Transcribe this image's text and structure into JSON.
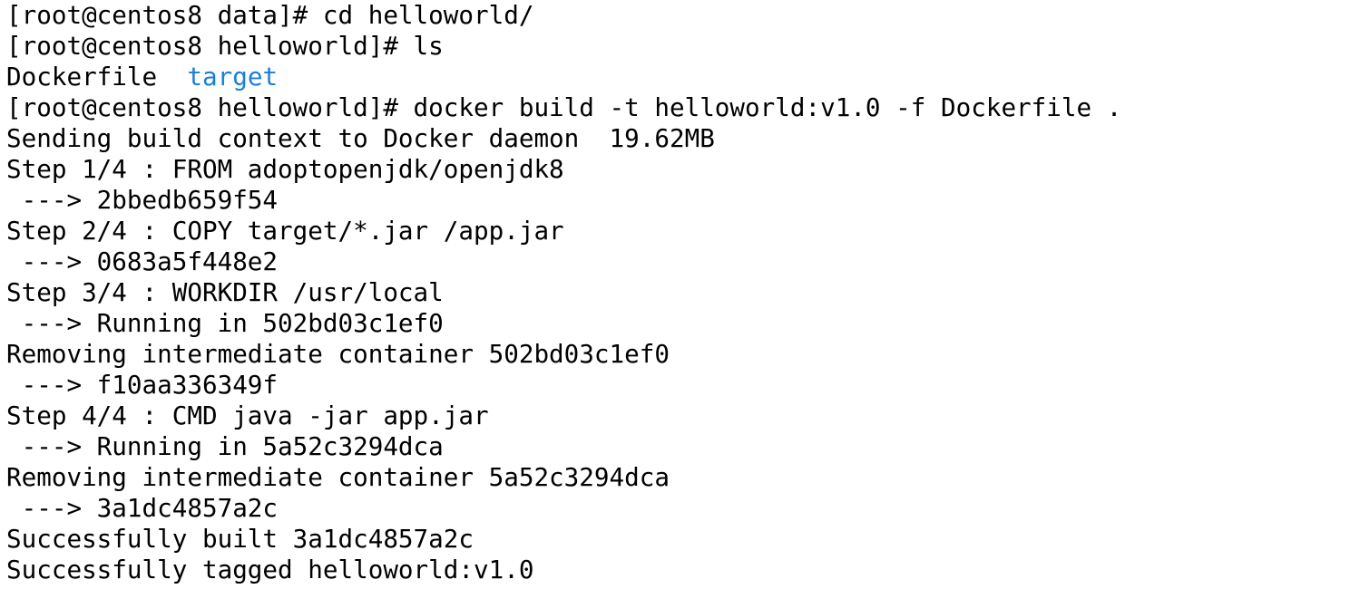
{
  "terminal": {
    "lines": [
      "[root@centos8 data]# cd helloworld/",
      "[root@centos8 helloworld]# ls",
      "Sending build context to Docker daemon  19.62MB",
      "[root@centos8 helloworld]# docker build -t helloworld:v1.0 -f Dockerfile .",
      "Step 1/4 : FROM adoptopenjdk/openjdk8",
      " ---> 2bbedb659f54",
      "Step 2/4 : COPY target/*.jar /app.jar",
      " ---> 0683a5f448e2",
      "Step 3/4 : WORKDIR /usr/local",
      " ---> Running in 502bd03c1ef0",
      "Removing intermediate container 502bd03c1ef0",
      " ---> f10aa336349f",
      "Step 4/4 : CMD java -jar app.jar",
      " ---> Running in 5a52c3294dca",
      "Removing intermediate container 5a52c3294dca",
      " ---> 3a1dc4857a2c",
      "Successfully built 3a1dc4857a2c",
      "Successfully tagged helloworld:v1.0"
    ],
    "ls_output": {
      "file": "Dockerfile",
      "dir": "target"
    }
  },
  "colors": {
    "background": "#ffffff",
    "text": "#000000",
    "directory": "#1a7fdb"
  }
}
